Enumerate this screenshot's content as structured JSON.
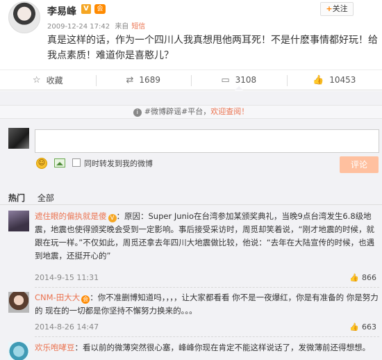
{
  "post": {
    "author": "李易峰",
    "verified_badge": "V",
    "member_badge": "会",
    "follow_button": "关注",
    "follow_plus": "+",
    "timestamp": "2009-12-24 17:42",
    "source_prefix": "来自",
    "source": "短信",
    "text": "真是这样的话，作为一个四川人我真想甩他两耳死！不是什麽事情都好玩！给我点素质！难道你是喜憨儿？"
  },
  "actions": [
    {
      "icon": "star-icon",
      "glyph": "☆",
      "label": "收藏"
    },
    {
      "icon": "repost-icon",
      "glyph": "⇄",
      "label": "1689"
    },
    {
      "icon": "comment-icon",
      "glyph": "▭",
      "label": "3108"
    },
    {
      "icon": "like-icon",
      "glyph": "👍",
      "label": "10453"
    }
  ],
  "notice": {
    "text": "#微博辟谣#平台，",
    "link": "欢迎查阅！"
  },
  "composer": {
    "input_value": "",
    "repost_label": "同时转发到我的微博",
    "submit_label": "评论"
  },
  "tabs": {
    "hot": "热门",
    "all": "全部"
  },
  "comments": [
    {
      "user": "遮住眼的偏执就是傻",
      "badge": "V",
      "text": "：原因：Super Junio在台湾参加某颁奖典礼，当晚9点台湾发生6.8级地震，地震也使得颁奖晚会受到一定影响。事后接受采访时，周觅却笑着说，“刚才地震的时候，就跟在玩一样。”不仅如此，周觅还拿去年四川大地震做比较，他说：“去年在大陆宣传的时候，也遇到地震，还挺开心的”",
      "date": "2014-9-15 11:31",
      "likes": "866"
    },
    {
      "user": "CNM-田大大",
      "badge": "会",
      "text": "：你不准删博知道吗，，，，让大家都看看 你不是一夜爆红，你是有准备的 你是努力的 现在的一切都是你坚持不懈努力换来的。。。",
      "date": "2014-8-26 14:47",
      "likes": "663"
    },
    {
      "user": "欢乐咆哮豆",
      "badge": "",
      "text": "：看以前的微薄突然很心塞，峰峰你现在肯定不能这样说话了，发微薄前还得想想。",
      "date": "",
      "likes": ""
    }
  ],
  "colors": {
    "accent": "#eb7350",
    "verified": "#f5a623",
    "submit_bg": "#ffc09f",
    "comment_bg": "#f2f2f5"
  }
}
